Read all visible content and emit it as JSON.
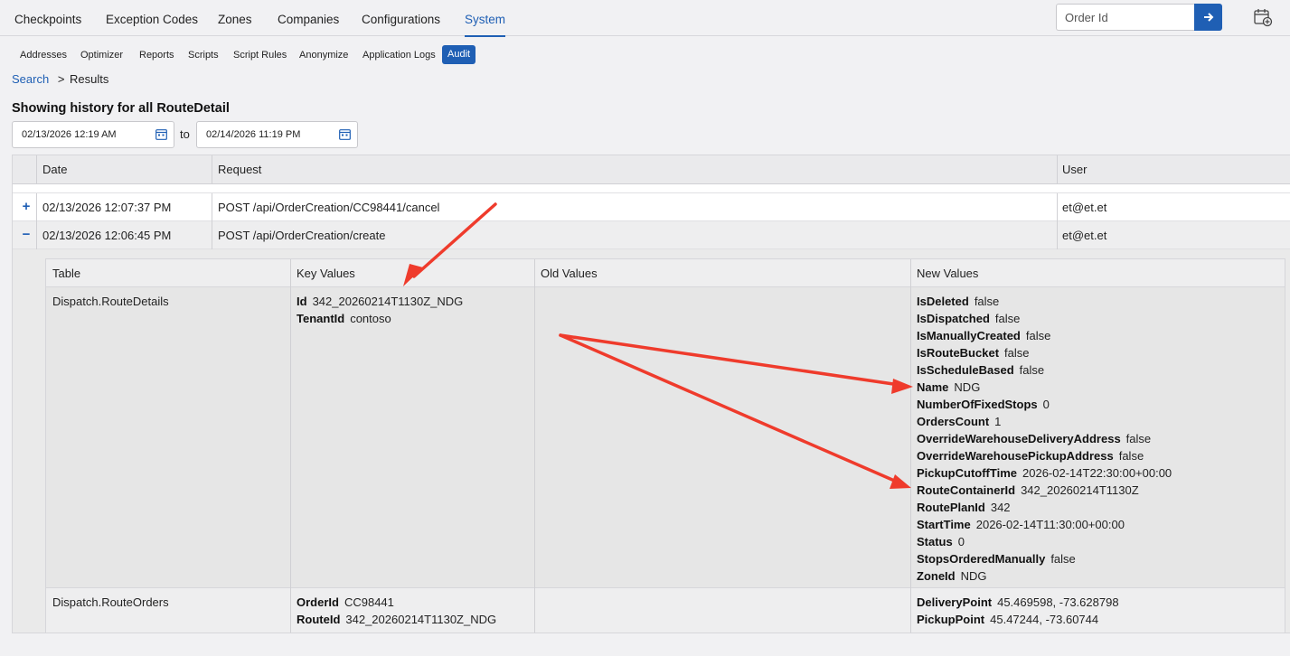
{
  "topnav": {
    "tabs": [
      {
        "label": "Checkpoints"
      },
      {
        "label": "Exception Codes"
      },
      {
        "label": "Zones"
      },
      {
        "label": "Companies"
      },
      {
        "label": "Configurations"
      },
      {
        "label": "System",
        "active": true
      }
    ],
    "order_search": {
      "placeholder": "Order Id"
    }
  },
  "subnav": {
    "items": [
      {
        "label": "Addresses"
      },
      {
        "label": "Optimizer"
      },
      {
        "label": "Reports"
      },
      {
        "label": "Scripts"
      },
      {
        "label": "Script Rules"
      },
      {
        "label": "Anonymize"
      },
      {
        "label": "Application Logs"
      },
      {
        "label": "Audit",
        "active": true
      }
    ]
  },
  "breadcrumb": {
    "search": "Search",
    "separator": ">",
    "current": "Results"
  },
  "heading": "Showing history for all RouteDetail",
  "date_range": {
    "from": "02/13/2026 12:19 AM",
    "to_label": "to",
    "to": "02/14/2026 11:19 PM"
  },
  "table": {
    "columns": {
      "date": "Date",
      "request": "Request",
      "user": "User"
    },
    "rows": [
      {
        "toggle": "+",
        "date": "02/13/2026 12:07:37 PM",
        "request": "POST /api/OrderCreation/CC98441/cancel",
        "user": "et@et.et"
      },
      {
        "toggle": "−",
        "date": "02/13/2026 12:06:45 PM",
        "request": "POST /api/OrderCreation/create",
        "user": "et@et.et"
      }
    ]
  },
  "detail": {
    "columns": {
      "table": "Table",
      "key_values": "Key Values",
      "old_values": "Old Values",
      "new_values": "New Values"
    },
    "rows": [
      {
        "table": "Dispatch.RouteDetails",
        "key_values": [
          {
            "k": "Id",
            "v": "342_20260214T1130Z_NDG"
          },
          {
            "k": "TenantId",
            "v": "contoso"
          }
        ],
        "new_values": [
          {
            "k": "IsDeleted",
            "v": "false"
          },
          {
            "k": "IsDispatched",
            "v": "false"
          },
          {
            "k": "IsManuallyCreated",
            "v": "false"
          },
          {
            "k": "IsRouteBucket",
            "v": "false"
          },
          {
            "k": "IsScheduleBased",
            "v": "false"
          },
          {
            "k": "Name",
            "v": "NDG"
          },
          {
            "k": "NumberOfFixedStops",
            "v": "0"
          },
          {
            "k": "OrdersCount",
            "v": "1"
          },
          {
            "k": "OverrideWarehouseDeliveryAddress",
            "v": "false"
          },
          {
            "k": "OverrideWarehousePickupAddress",
            "v": "false"
          },
          {
            "k": "PickupCutoffTime",
            "v": "2026-02-14T22:30:00+00:00"
          },
          {
            "k": "RouteContainerId",
            "v": "342_20260214T1130Z"
          },
          {
            "k": "RoutePlanId",
            "v": "342"
          },
          {
            "k": "StartTime",
            "v": "2026-02-14T11:30:00+00:00"
          },
          {
            "k": "Status",
            "v": "0"
          },
          {
            "k": "StopsOrderedManually",
            "v": "false"
          },
          {
            "k": "ZoneId",
            "v": "NDG"
          }
        ]
      },
      {
        "table": "Dispatch.RouteOrders",
        "key_values": [
          {
            "k": "OrderId",
            "v": "CC98441"
          },
          {
            "k": "RouteId",
            "v": "342_20260214T1130Z_NDG"
          }
        ],
        "new_values": [
          {
            "k": "DeliveryPoint",
            "v": "45.469598, -73.628798"
          },
          {
            "k": "PickupPoint",
            "v": "45.47244, -73.60744"
          }
        ]
      }
    ]
  },
  "colors": {
    "accent": "#1f5fb4",
    "annotation_arrow": "#ef3b2c"
  }
}
